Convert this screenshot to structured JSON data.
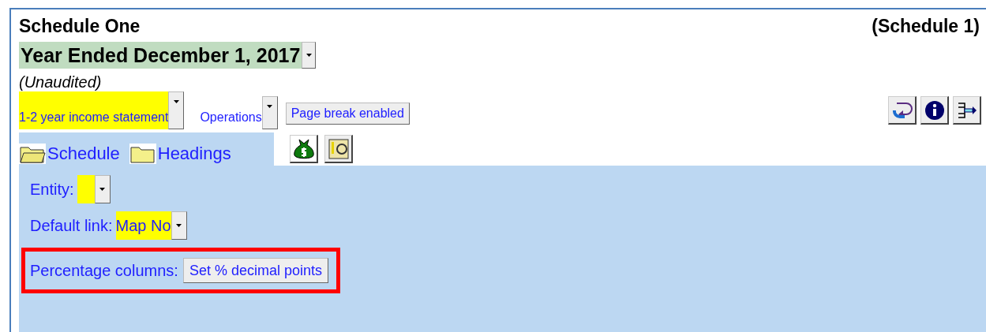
{
  "header": {
    "title": "Schedule One",
    "reference": "(Schedule 1)"
  },
  "period": {
    "value": "Year Ended December 1, 2017"
  },
  "note": "(Unaudited)",
  "toolbar": {
    "template": "1-2 year income statement",
    "section": "Operations",
    "page_break_button": "Page break enabled"
  },
  "tabs": [
    {
      "label": "Schedule",
      "selected": true
    },
    {
      "label": "Headings",
      "selected": false
    }
  ],
  "settings": {
    "entity_label": "Entity:",
    "default_link_label": "Default link:",
    "default_link_value": "Map No",
    "percentage_label": "Percentage columns:",
    "percentage_button": "Set % decimal points",
    "percentage_highlighted": true
  }
}
